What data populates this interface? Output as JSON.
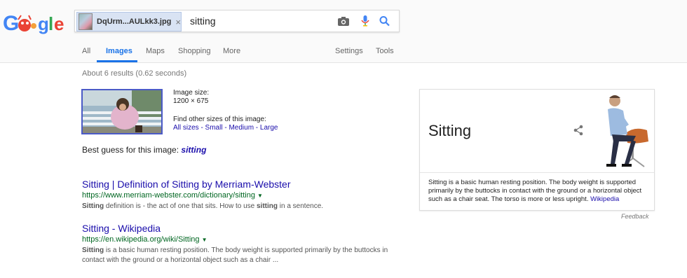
{
  "logo": {
    "letters": [
      "G",
      "o",
      "o",
      "g",
      "l",
      "e"
    ],
    "colors": [
      "#4285f4",
      "#ea4335",
      "#fbbc05",
      "#4285f4",
      "#34a853",
      "#ea4335"
    ]
  },
  "search": {
    "image_chip": {
      "filename": "DqUrm...AULkk3.jpg",
      "close": "×"
    },
    "query": "sitting",
    "icons": [
      "camera-icon",
      "microphone-icon",
      "search-icon"
    ]
  },
  "tabs": {
    "items": [
      "All",
      "Images",
      "Maps",
      "Shopping",
      "More"
    ],
    "active": "Images",
    "right": [
      "Settings",
      "Tools"
    ]
  },
  "results_stats": "About 6 results (0.62 seconds)",
  "image_info": {
    "size_label": "Image size:",
    "size_value": "1200 × 675",
    "find_label": "Find other sizes of this image:",
    "sizes_links": "All sizes - Small - Medium - Large"
  },
  "best_guess": {
    "prefix": "Best guess for this image:",
    "term": "sitting"
  },
  "results": [
    {
      "title": "Sitting | Definition of Sitting by Merriam-Webster",
      "url": "https://www.merriam-webster.com/dictionary/sitting",
      "snippet_bold": "Sitting",
      "snippet_a": " definition is - the act of one that sits. How to use ",
      "snippet_b": "sitting",
      "snippet_c": " in a sentence."
    },
    {
      "title": "Sitting - Wikipedia",
      "url": "https://en.wikipedia.org/wiki/Sitting",
      "snippet_bold": "Sitting",
      "snippet_a": " is a basic human resting position. The body weight is supported primarily by the buttocks in contact with the ground or a horizontal object such as a chair ..."
    }
  ],
  "knowledge_panel": {
    "title": "Sitting",
    "description": "Sitting is a basic human resting position. The body weight is supported primarily by the buttocks in contact with the ground or a horizontal object such as a chair seat. The torso is more or less upright.",
    "source": "Wikipedia"
  },
  "feedback": "Feedback"
}
